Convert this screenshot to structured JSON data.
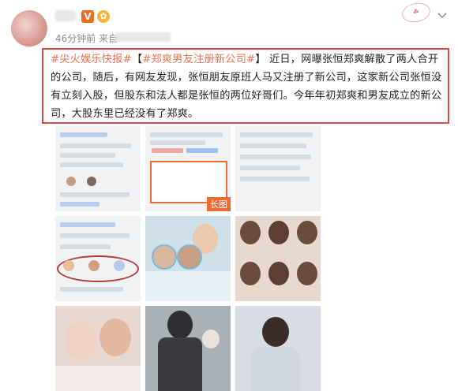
{
  "post": {
    "time": "46分钟前",
    "source_prefix": "来自",
    "v_badge": "V",
    "hashtag_1": "#尖火娱乐快报#",
    "hashtag_2_open": "【",
    "hashtag_2": "#郑爽男友注册新公司#",
    "hashtag_2_close": "】",
    "body": "近日，网曝张恒郑爽解散了两人合开的公司，随后，有网友发现，张恒朋友原班人马又注册了新公司，这家新公司张恒没有立刻入股，但股东和法人都是张恒的两位好哥们。今年年初郑爽和男友成立的新公司，大股东里已经没有了郑爽。"
  },
  "images": {
    "long_image_badge": "长图"
  },
  "colors": {
    "highlight_border": "#d54b4b",
    "hashtag": "#eb7350",
    "verified": "#f26a1b"
  },
  "icons": [
    "avatar",
    "verified-icon",
    "cat-emoji-icon",
    "chevron-down-icon",
    "watermark-stamp"
  ]
}
